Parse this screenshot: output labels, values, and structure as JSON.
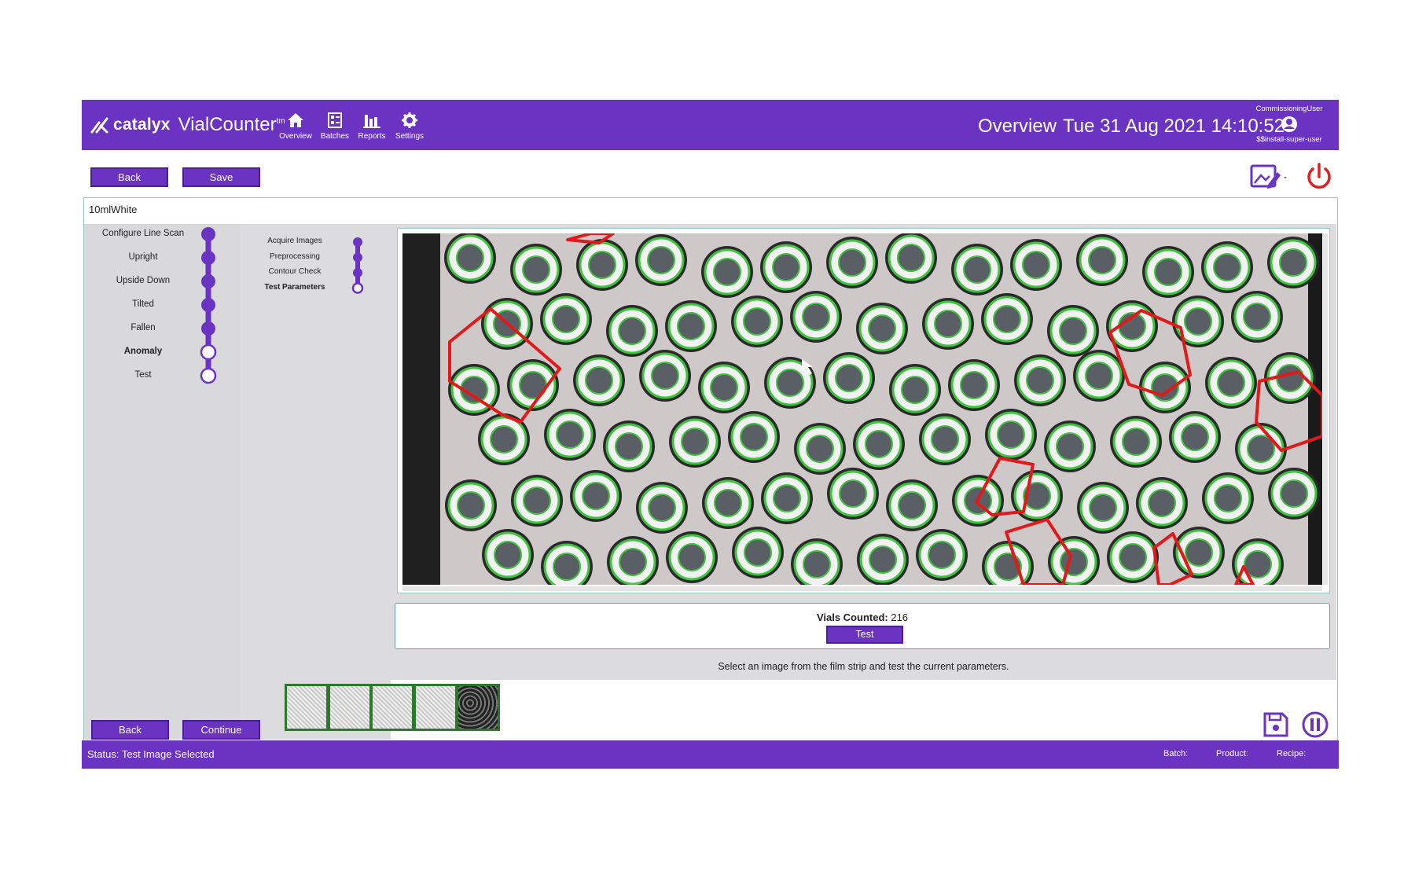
{
  "app": {
    "brand": "catalyx",
    "product": "VialCounter",
    "trademark": "tm"
  },
  "nav": [
    {
      "label": "Overview",
      "icon": "home-icon"
    },
    {
      "label": "Batches",
      "icon": "batches-icon"
    },
    {
      "label": "Reports",
      "icon": "bar-chart-icon"
    },
    {
      "label": "Settings",
      "icon": "gear-icon"
    }
  ],
  "header": {
    "page_title": "Overview",
    "datetime": "Tue 31 Aug 2021 14:10:52",
    "user_role": "CommissioningUser",
    "user_name": "$$install-super-user"
  },
  "toolbar": {
    "back_label": "Back",
    "save_label": "Save"
  },
  "recipe": {
    "name": "10mlWhite"
  },
  "steps": [
    {
      "label": "Configure Line Scan",
      "done": true,
      "active": false
    },
    {
      "label": "Upright",
      "done": true,
      "active": false
    },
    {
      "label": "Upside Down",
      "done": true,
      "active": false
    },
    {
      "label": "Tilted",
      "done": true,
      "active": false
    },
    {
      "label": "Fallen",
      "done": true,
      "active": false
    },
    {
      "label": "Anomaly",
      "done": false,
      "active": true
    },
    {
      "label": "Test",
      "done": false,
      "active": false
    }
  ],
  "substeps": [
    {
      "label": "Acquire Images",
      "done": true,
      "active": false
    },
    {
      "label": "Preprocessing",
      "done": true,
      "active": false
    },
    {
      "label": "Contour Check",
      "done": true,
      "active": false
    },
    {
      "label": "Test Parameters",
      "done": false,
      "active": true
    }
  ],
  "result": {
    "count_label": "Vials Counted:",
    "count_value": "216",
    "test_label": "Test"
  },
  "hint": "Select an image from the film strip and test the current parameters.",
  "filmstrip": {
    "thumbnail_count": 5,
    "selected_index": 4
  },
  "footer": {
    "back_label": "Back",
    "continue_label": "Continue"
  },
  "status": {
    "text": "Status: Test Image Selected",
    "batch_label": "Batch:",
    "product_label": "Product:",
    "recipe_label": "Recipe:"
  },
  "colors": {
    "primary": "#6a33c2",
    "accent_green": "#3fc43f",
    "anomaly_red": "#e01a1a",
    "power_red": "#e02020"
  }
}
